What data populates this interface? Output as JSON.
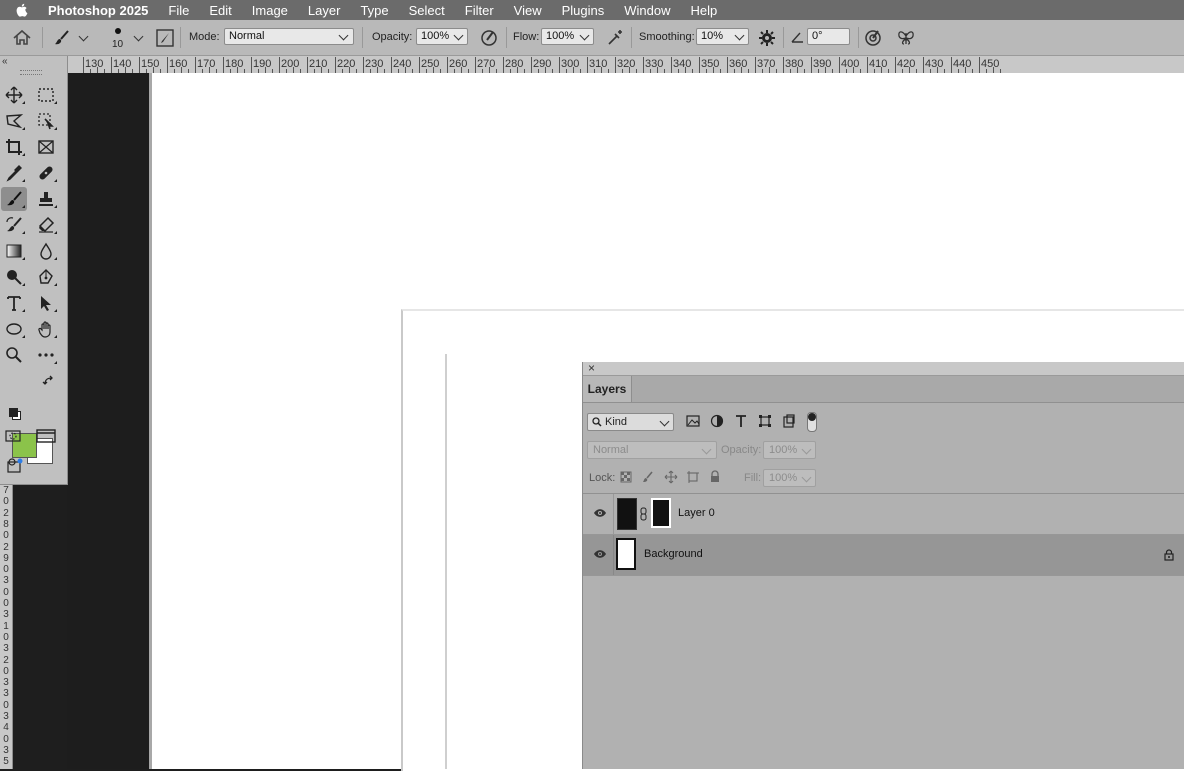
{
  "menubar": {
    "app_name": "Photoshop 2025",
    "items": [
      "File",
      "Edit",
      "Image",
      "Layer",
      "Type",
      "Select",
      "Filter",
      "View",
      "Plugins",
      "Window",
      "Help"
    ]
  },
  "options": {
    "brush_size": "10",
    "mode_label": "Mode:",
    "mode_value": "Normal",
    "opacity_label": "Opacity:",
    "opacity_value": "100%",
    "flow_label": "Flow:",
    "flow_value": "100%",
    "smoothing_label": "Smoothing:",
    "smoothing_value": "10%",
    "angle_value": "0°"
  },
  "ruler": {
    "labels": [
      "130",
      "140",
      "150",
      "160",
      "170",
      "180",
      "190",
      "200",
      "210",
      "220",
      "230",
      "240",
      "250",
      "260",
      "270",
      "280",
      "290",
      "300",
      "310",
      "320",
      "330",
      "340",
      "350",
      "360",
      "370",
      "380",
      "390",
      "400",
      "410",
      "420",
      "430",
      "440",
      "450"
    ]
  },
  "vruler": {
    "labels": [
      "7",
      "0",
      "2",
      "8",
      "0",
      "2",
      "9",
      "0",
      "3",
      "0",
      "0",
      "3",
      "1",
      "0",
      "3",
      "2",
      "0",
      "3",
      "3",
      "0",
      "3",
      "4",
      "0",
      "3",
      "5"
    ]
  },
  "colors": {
    "foreground": "#8bc34a",
    "background": "#ffffff"
  },
  "layers_panel": {
    "tab_label": "Layers",
    "filter_kind": "Kind",
    "blend_mode": "Normal",
    "opacity_label": "Opacity:",
    "opacity_value": "100%",
    "lock_label": "Lock:",
    "fill_label": "Fill:",
    "fill_value": "100%",
    "layers": [
      {
        "name": "Layer 0",
        "visible": true,
        "has_mask": true
      },
      {
        "name": "Background",
        "visible": true,
        "locked": true
      }
    ]
  }
}
